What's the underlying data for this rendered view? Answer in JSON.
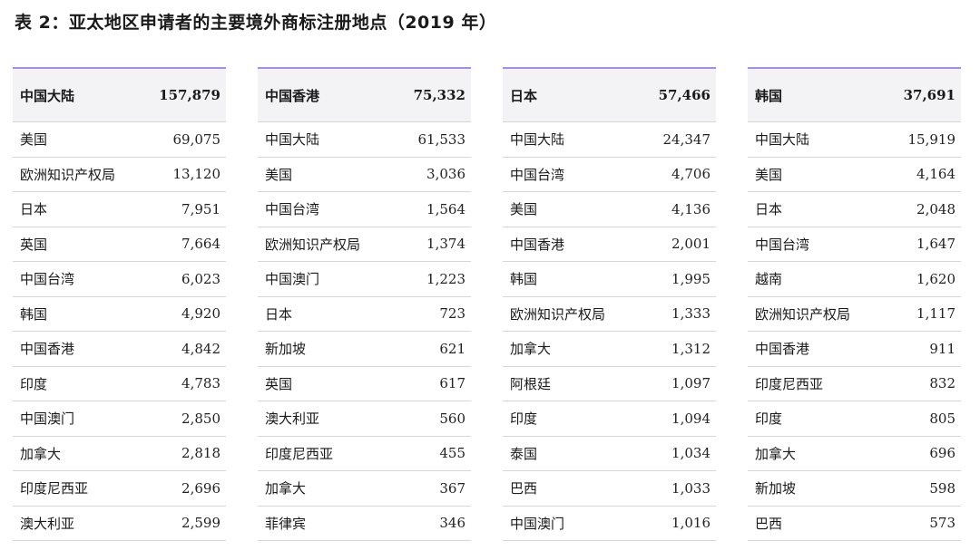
{
  "title": "表 2：亚太地区申请者的主要境外商标注册地点（2019 年）",
  "tables": [
    {
      "header": {
        "name": "中国大陆",
        "value": "157,879"
      },
      "rows": [
        {
          "name": "美国",
          "value": "69,075"
        },
        {
          "name": "欧洲知识产权局",
          "value": "13,120"
        },
        {
          "name": "日本",
          "value": "7,951"
        },
        {
          "name": "英国",
          "value": "7,664"
        },
        {
          "name": "中国台湾",
          "value": "6,023"
        },
        {
          "name": "韩国",
          "value": "4,920"
        },
        {
          "name": "中国香港",
          "value": "4,842"
        },
        {
          "name": "印度",
          "value": "4,783"
        },
        {
          "name": "中国澳门",
          "value": "2,850"
        },
        {
          "name": "加拿大",
          "value": "2,818"
        },
        {
          "name": "印度尼西亚",
          "value": "2,696"
        },
        {
          "name": "澳大利亚",
          "value": "2,599"
        }
      ]
    },
    {
      "header": {
        "name": "中国香港",
        "value": "75,332"
      },
      "rows": [
        {
          "name": "中国大陆",
          "value": "61,533"
        },
        {
          "name": "美国",
          "value": "3,036"
        },
        {
          "name": "中国台湾",
          "value": "1,564"
        },
        {
          "name": "欧洲知识产权局",
          "value": "1,374"
        },
        {
          "name": "中国澳门",
          "value": "1,223"
        },
        {
          "name": "日本",
          "value": "723"
        },
        {
          "name": "新加坡",
          "value": "621"
        },
        {
          "name": "英国",
          "value": "617"
        },
        {
          "name": "澳大利亚",
          "value": "560"
        },
        {
          "name": "印度尼西亚",
          "value": "455"
        },
        {
          "name": "加拿大",
          "value": "367"
        },
        {
          "name": "菲律宾",
          "value": "346"
        }
      ]
    },
    {
      "header": {
        "name": "日本",
        "value": "57,466"
      },
      "rows": [
        {
          "name": "中国大陆",
          "value": "24,347"
        },
        {
          "name": "中国台湾",
          "value": "4,706"
        },
        {
          "name": "美国",
          "value": "4,136"
        },
        {
          "name": "中国香港",
          "value": "2,001"
        },
        {
          "name": "韩国",
          "value": "1,995"
        },
        {
          "name": "欧洲知识产权局",
          "value": "1,333"
        },
        {
          "name": "加拿大",
          "value": "1,312"
        },
        {
          "name": "阿根廷",
          "value": "1,097"
        },
        {
          "name": "印度",
          "value": "1,094"
        },
        {
          "name": "泰国",
          "value": "1,034"
        },
        {
          "name": "巴西",
          "value": "1,033"
        },
        {
          "name": "中国澳门",
          "value": "1,016"
        }
      ]
    },
    {
      "header": {
        "name": "韩国",
        "value": "37,691"
      },
      "rows": [
        {
          "name": "中国大陆",
          "value": "15,919"
        },
        {
          "name": "美国",
          "value": "4,164"
        },
        {
          "name": "日本",
          "value": "2,048"
        },
        {
          "name": "中国台湾",
          "value": "1,647"
        },
        {
          "name": "越南",
          "value": "1,620"
        },
        {
          "name": "欧洲知识产权局",
          "value": "1,117"
        },
        {
          "name": "中国香港",
          "value": "911"
        },
        {
          "name": "印度尼西亚",
          "value": "832"
        },
        {
          "name": "印度",
          "value": "805"
        },
        {
          "name": "加拿大",
          "value": "696"
        },
        {
          "name": "新加坡",
          "value": "598"
        },
        {
          "name": "巴西",
          "value": "573"
        }
      ]
    }
  ]
}
